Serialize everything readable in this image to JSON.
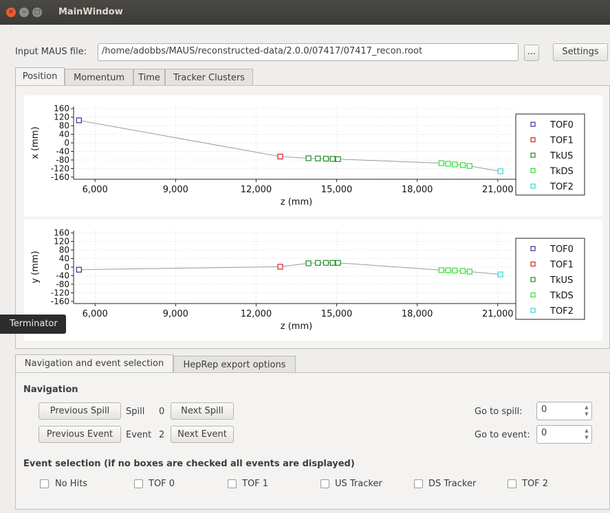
{
  "window": {
    "title": "MainWindow"
  },
  "file": {
    "label": "Input MAUS file:",
    "path": "/home/adobbs/MAUS/reconstructed-data/2.0.0/07417/07417_recon.root",
    "browse_label": "...",
    "settings_label": "Settings"
  },
  "plot_tabs": [
    "Position",
    "Momentum",
    "Time",
    "Tracker Clusters"
  ],
  "colors": {
    "TOF0": "#2f2f9e",
    "TOF1": "#d62020",
    "TkUS": "#1a8a1a",
    "TkDS": "#33dd33",
    "TOF2": "#33d6d6",
    "line": "#9a9a9a"
  },
  "chart_data": [
    {
      "type": "scatter",
      "xlabel": "z (mm)",
      "ylabel": "x (mm)",
      "xlim": [
        5200,
        21800
      ],
      "ylim": [
        -170,
        170
      ],
      "xticks": [
        "6,000",
        "9,000",
        "12,000",
        "15,000",
        "18,000",
        "21,000"
      ],
      "yticks": [
        "160",
        "120",
        "80",
        "40",
        "0",
        "-40",
        "-80",
        "-120",
        "-160"
      ],
      "legend_position": "right",
      "series": [
        {
          "name": "TOF0",
          "points": [
            [
              5400,
              105
            ]
          ]
        },
        {
          "name": "TOF1",
          "points": [
            [
              12900,
              -64
            ]
          ]
        },
        {
          "name": "TkUS",
          "points": [
            [
              13950,
              -72
            ],
            [
              14300,
              -73
            ],
            [
              14600,
              -74
            ],
            [
              14850,
              -75
            ],
            [
              15050,
              -76
            ]
          ]
        },
        {
          "name": "TkDS",
          "points": [
            [
              18900,
              -95
            ],
            [
              19150,
              -98
            ],
            [
              19400,
              -101
            ],
            [
              19700,
              -104
            ],
            [
              19950,
              -108
            ]
          ]
        },
        {
          "name": "TOF2",
          "points": [
            [
              21100,
              -133
            ]
          ]
        }
      ]
    },
    {
      "type": "scatter",
      "xlabel": "z (mm)",
      "ylabel": "y (mm)",
      "xlim": [
        5200,
        21800
      ],
      "ylim": [
        -170,
        170
      ],
      "xticks": [
        "6,000",
        "9,000",
        "12,000",
        "15,000",
        "18,000",
        "21,000"
      ],
      "yticks": [
        "160",
        "120",
        "80",
        "40",
        "0",
        "-40",
        "-80",
        "-120",
        "-160"
      ],
      "legend_position": "right",
      "series": [
        {
          "name": "TOF0",
          "points": [
            [
              5400,
              -12
            ]
          ]
        },
        {
          "name": "TOF1",
          "points": [
            [
              12900,
              2
            ]
          ]
        },
        {
          "name": "TkUS",
          "points": [
            [
              13950,
              18
            ],
            [
              14300,
              20
            ],
            [
              14600,
              20
            ],
            [
              14850,
              20
            ],
            [
              15050,
              20
            ]
          ]
        },
        {
          "name": "TkDS",
          "points": [
            [
              18900,
              -14
            ],
            [
              19150,
              -15
            ],
            [
              19400,
              -16
            ],
            [
              19700,
              -18
            ],
            [
              19950,
              -21
            ]
          ]
        },
        {
          "name": "TOF2",
          "points": [
            [
              21100,
              -34
            ]
          ]
        }
      ]
    }
  ],
  "tooltip": "Terminator",
  "bottom_tabs": [
    "Navigation and event selection",
    "HepRep export options"
  ],
  "navigation": {
    "heading": "Navigation",
    "prev_spill": "Previous Spill",
    "spill_label": "Spill",
    "spill_value": "0",
    "next_spill": "Next Spill",
    "prev_event": "Previous Event",
    "event_label": "Event",
    "event_value": "2",
    "next_event": "Next Event",
    "goto_spill_label": "Go to spill:",
    "goto_spill_value": "0",
    "goto_event_label": "Go to event:",
    "goto_event_value": "0"
  },
  "selection": {
    "heading": "Event selection (if no boxes are checked all events are displayed)",
    "checkboxes": [
      "No Hits",
      "TOF 0",
      "TOF 1",
      "US Tracker",
      "DS Tracker",
      "TOF 2"
    ]
  }
}
